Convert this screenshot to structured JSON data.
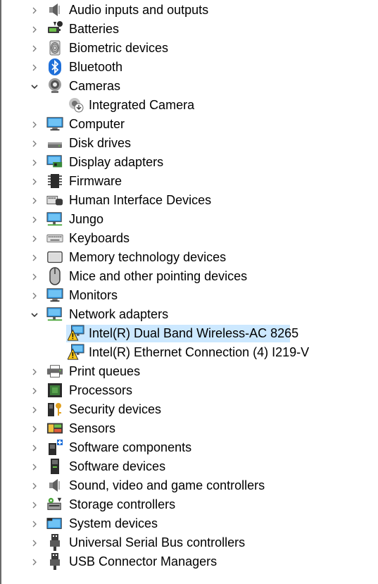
{
  "tree": [
    {
      "label": "Audio inputs and outputs",
      "icon": "speaker-icon",
      "expanded": false
    },
    {
      "label": "Batteries",
      "icon": "battery-icon",
      "expanded": false
    },
    {
      "label": "Biometric devices",
      "icon": "fingerprint-icon",
      "expanded": false
    },
    {
      "label": "Bluetooth",
      "icon": "bluetooth-icon",
      "expanded": false
    },
    {
      "label": "Cameras",
      "icon": "webcam-icon",
      "expanded": true
    },
    {
      "label": "Integrated Camera",
      "icon": "camera-device-icon",
      "child": true
    },
    {
      "label": "Computer",
      "icon": "monitor-icon",
      "expanded": false
    },
    {
      "label": "Disk drives",
      "icon": "disk-drive-icon",
      "expanded": false
    },
    {
      "label": "Display adapters",
      "icon": "display-adapter-icon",
      "expanded": false
    },
    {
      "label": "Firmware",
      "icon": "chip-icon",
      "expanded": false
    },
    {
      "label": "Human Interface Devices",
      "icon": "hid-icon",
      "expanded": false
    },
    {
      "label": "Jungo",
      "icon": "network-monitor-icon",
      "expanded": false
    },
    {
      "label": "Keyboards",
      "icon": "keyboard-icon",
      "expanded": false
    },
    {
      "label": "Memory technology devices",
      "icon": "memory-card-icon",
      "expanded": false
    },
    {
      "label": "Mice and other pointing devices",
      "icon": "mouse-icon",
      "expanded": false
    },
    {
      "label": "Monitors",
      "icon": "monitor-icon",
      "expanded": false
    },
    {
      "label": "Network adapters",
      "icon": "network-monitor-icon",
      "expanded": true
    },
    {
      "label": "Intel(R) Dual Band Wireless-AC 8265",
      "icon": "network-warning-icon",
      "child": true,
      "selected": true
    },
    {
      "label": "Intel(R) Ethernet Connection (4) I219-V",
      "icon": "network-warning-icon",
      "child": true
    },
    {
      "label": "Print queues",
      "icon": "printer-icon",
      "expanded": false
    },
    {
      "label": "Processors",
      "icon": "processor-icon",
      "expanded": false
    },
    {
      "label": "Security devices",
      "icon": "security-key-icon",
      "expanded": false
    },
    {
      "label": "Sensors",
      "icon": "sensor-icon",
      "expanded": false
    },
    {
      "label": "Software components",
      "icon": "software-component-icon",
      "expanded": false
    },
    {
      "label": "Software devices",
      "icon": "software-device-icon",
      "expanded": false
    },
    {
      "label": "Sound, video and game controllers",
      "icon": "speaker-icon",
      "expanded": false
    },
    {
      "label": "Storage controllers",
      "icon": "storage-controller-icon",
      "expanded": false
    },
    {
      "label": "System devices",
      "icon": "system-folder-icon",
      "expanded": false
    },
    {
      "label": "Universal Serial Bus controllers",
      "icon": "usb-icon",
      "expanded": false
    },
    {
      "label": "USB Connector Managers",
      "icon": "usb-icon",
      "expanded": false
    }
  ],
  "colors": {
    "selection": "#cce8ff",
    "chevron": "#5a5a5a"
  }
}
